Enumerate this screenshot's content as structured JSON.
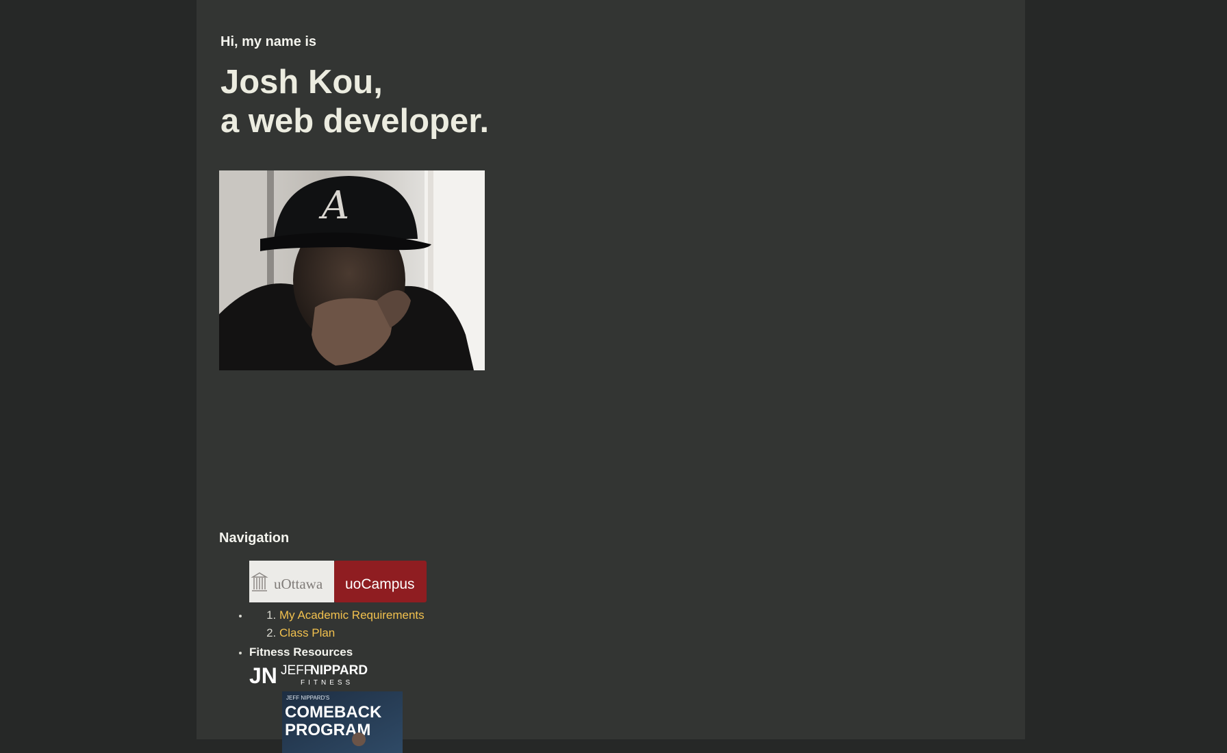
{
  "hero": {
    "greeting": "Hi, my name is",
    "name_line": "Josh Kou,",
    "role_line": "a web developer."
  },
  "nav": {
    "title": "Navigation",
    "uottawa_logo": {
      "left_text": "uOttawa",
      "right_text": "uoCampus",
      "colors": {
        "left_bg": "#ecebe8",
        "right_bg": "#8f1d21"
      }
    },
    "uottawa_links": [
      "My Academic Requirements",
      "Class Plan"
    ],
    "fitness_label": "Fitness Resources",
    "jn_logo": {
      "mark": "JN",
      "word_light": "JEFF",
      "word_bold": "NIPPARD",
      "subtitle": "FITNESS"
    },
    "program_card": {
      "kicker": "JEFF NIPPARD'S",
      "line1": "COMEBACK",
      "line2": "PROGRAM"
    }
  },
  "colors": {
    "page_bg": "#333533",
    "outer_bg": "#262827",
    "link": "#f2c14e",
    "heading": "#ecece0"
  }
}
